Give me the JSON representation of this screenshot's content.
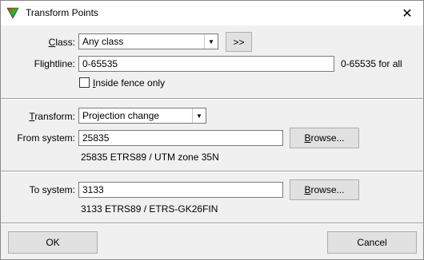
{
  "window": {
    "title": "Transform Points",
    "close_glyph": "✕",
    "app_icon": "triangle-color-icon"
  },
  "class_row": {
    "label_prefix": "",
    "label_accel": "C",
    "label_rest": "lass:",
    "selected": "Any class",
    "more_button": ">>"
  },
  "flightline_row": {
    "label": "Flightline:",
    "value": "0-65535",
    "hint": "0-65535 for all"
  },
  "fence": {
    "label_accel": "I",
    "label_rest": "nside fence only",
    "checked": false
  },
  "transform_row": {
    "label_accel": "T",
    "label_rest": "ransform:",
    "selected": "Projection change"
  },
  "from_system": {
    "label": "From system:",
    "value": "25835",
    "browse_accel": "B",
    "browse_rest": "rowse...",
    "description": "25835 ETRS89 / UTM zone 35N"
  },
  "to_system": {
    "label": "To system:",
    "value": "3133",
    "browse_accel": "B",
    "browse_rest": "rowse...",
    "description": "3133 ETRS89 / ETRS-GK26FIN"
  },
  "footer": {
    "ok_label": "OK",
    "cancel_label": "Cancel"
  }
}
